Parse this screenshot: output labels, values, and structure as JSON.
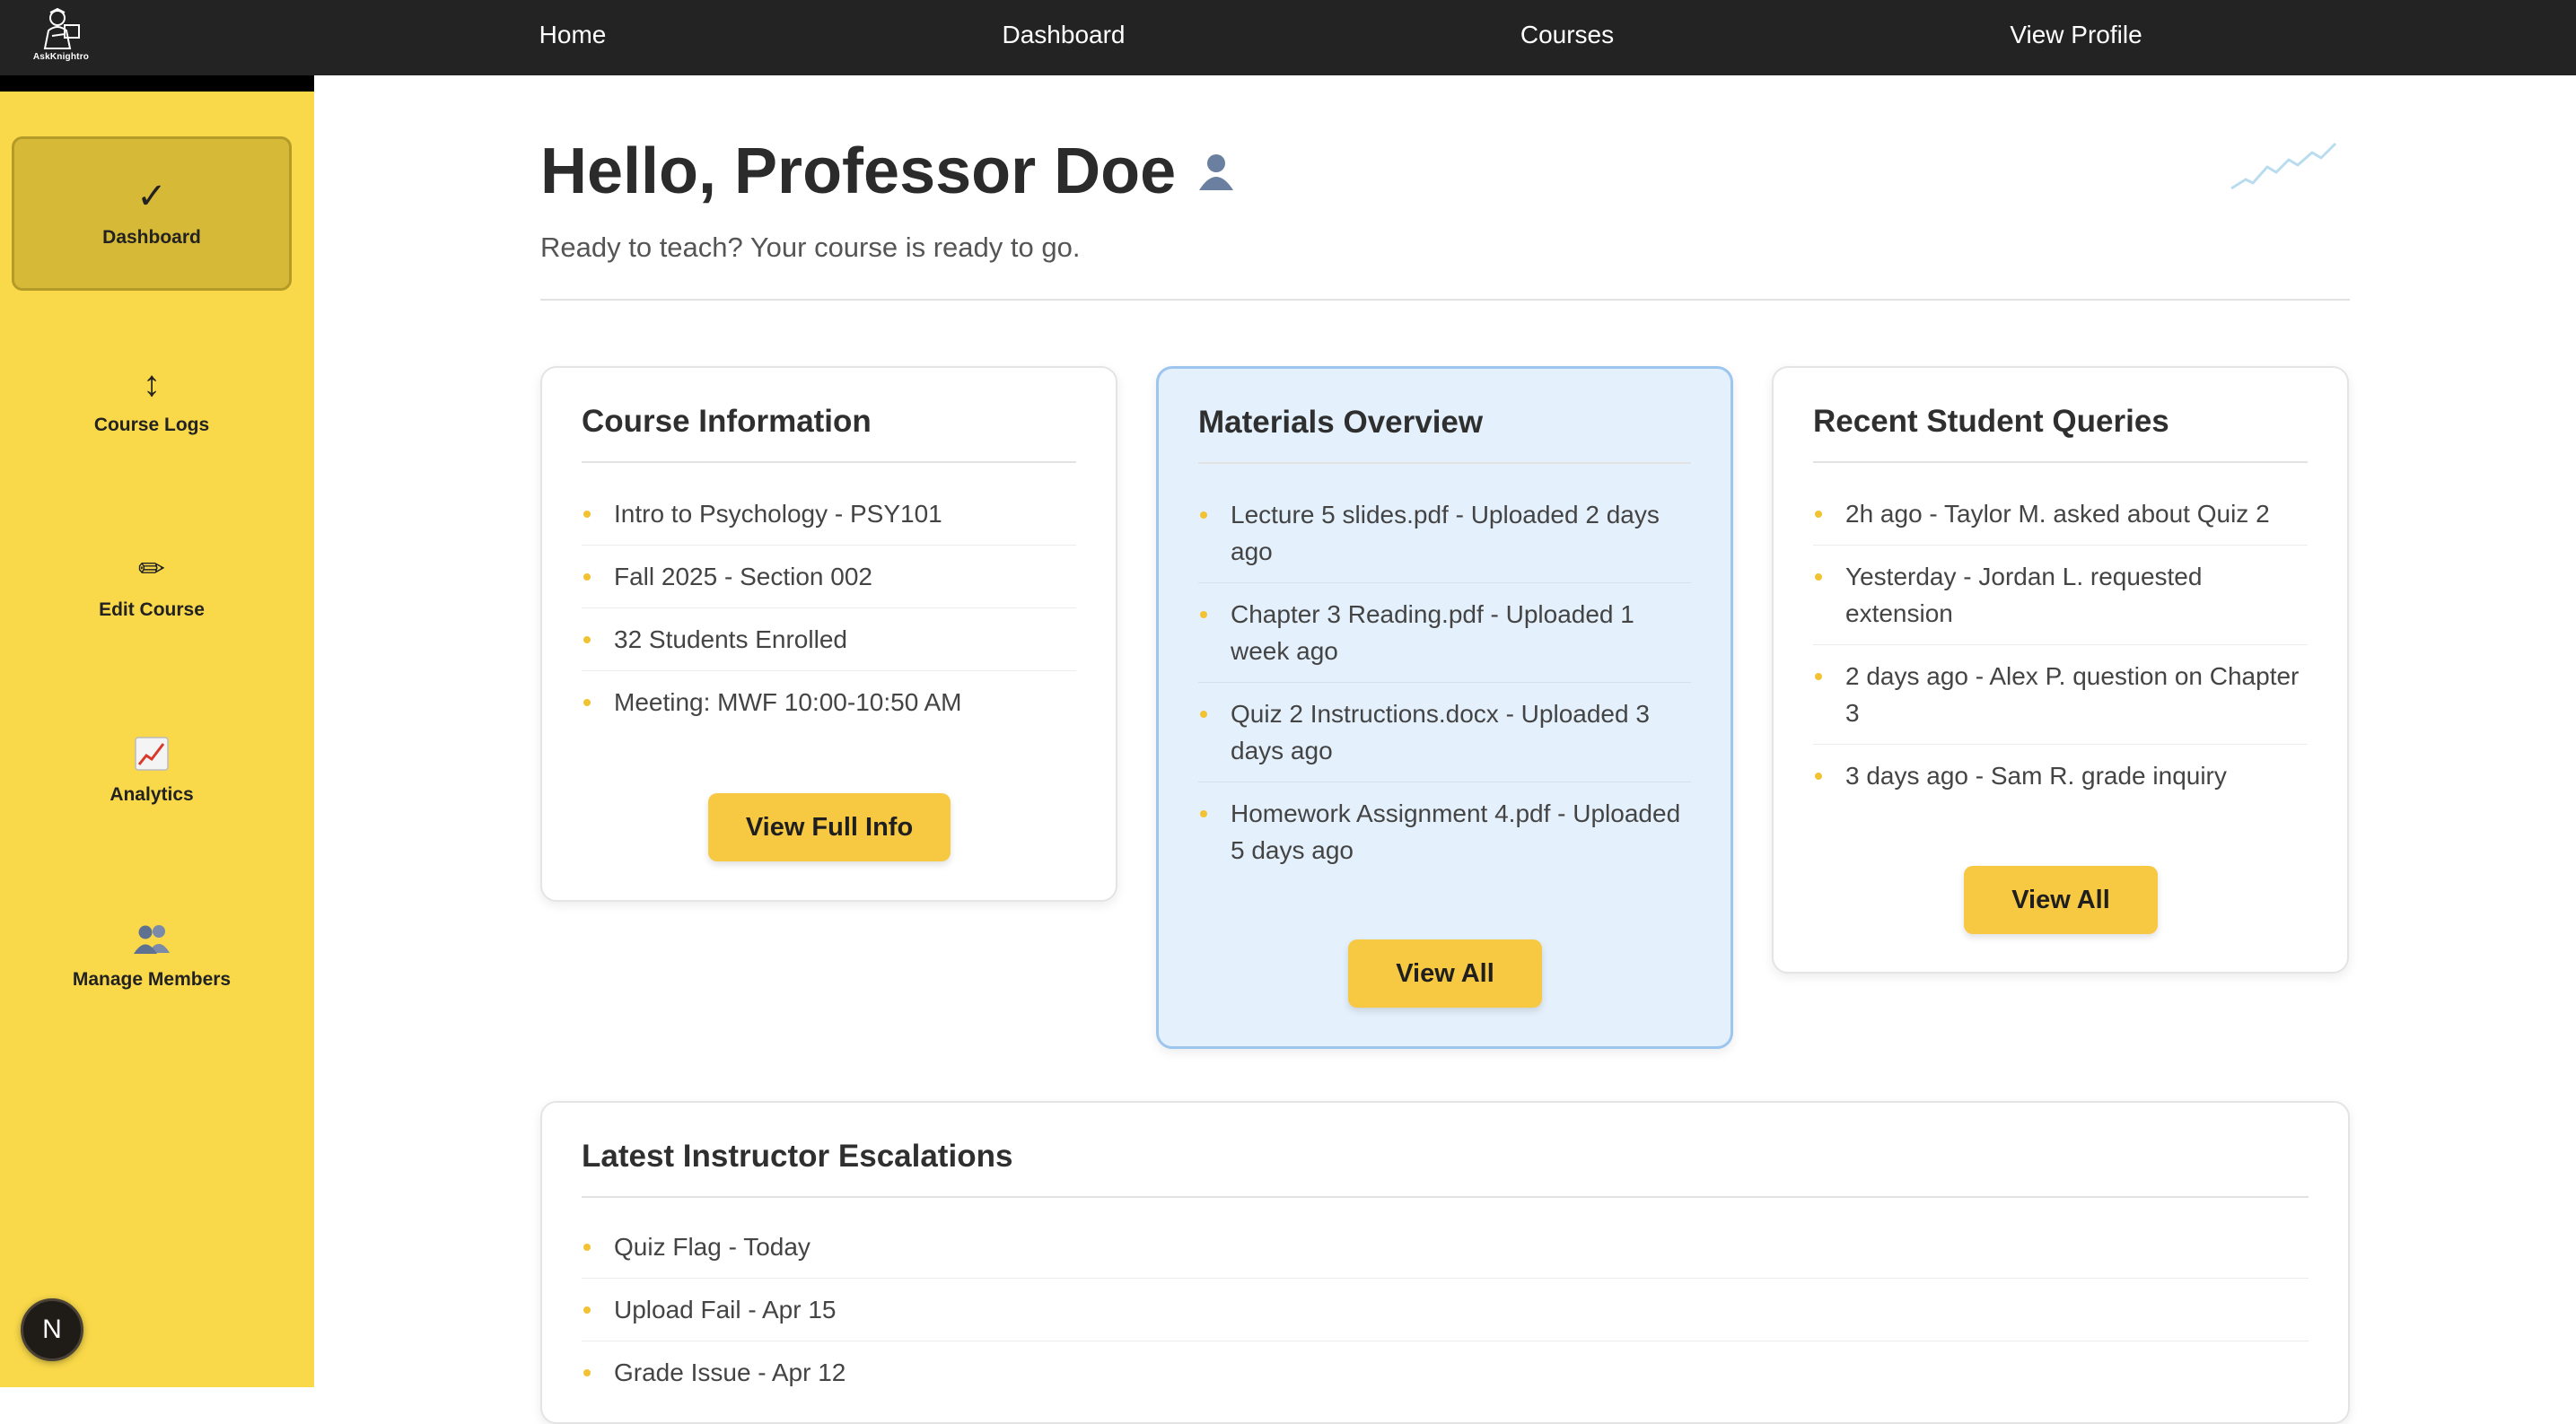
{
  "app": {
    "logo_text": "AskKnightro"
  },
  "nav": {
    "links": [
      "Home",
      "Dashboard",
      "Courses",
      "View Profile"
    ]
  },
  "sidebar": {
    "items": [
      {
        "label": "Dashboard",
        "icon": "checkmark-icon",
        "glyph": "✓",
        "active": true
      },
      {
        "label": "Course Logs",
        "icon": "up-down-arrow-icon",
        "glyph": "↕",
        "active": false
      },
      {
        "label": "Edit Course",
        "icon": "pencil-icon",
        "glyph": "✏",
        "active": false
      },
      {
        "label": "Analytics",
        "icon": "chart-increasing-icon",
        "glyph": "",
        "active": false
      },
      {
        "label": "Manage Members",
        "icon": "people-icon",
        "glyph": "",
        "active": false
      }
    ],
    "badge": "N"
  },
  "header": {
    "greeting": "Hello, Professor Doe",
    "subtitle": "Ready to teach? Your course is ready to go."
  },
  "cards": {
    "course_info": {
      "title": "Course Information",
      "items": [
        "Intro to Psychology - PSY101",
        "Fall 2025 - Section 002",
        "32 Students Enrolled",
        "Meeting: MWF 10:00-10:50 AM"
      ],
      "button": "View Full Info"
    },
    "materials": {
      "title": "Materials Overview",
      "items": [
        "Lecture 5 slides.pdf - Uploaded 2 days ago",
        "Chapter 3 Reading.pdf - Uploaded 1 week ago",
        "Quiz 2 Instructions.docx - Uploaded 3 days ago",
        "Homework Assignment 4.pdf - Uploaded 5 days ago"
      ],
      "button": "View All"
    },
    "queries": {
      "title": "Recent Student Queries",
      "items": [
        "2h ago - Taylor M. asked about Quiz 2",
        "Yesterday - Jordan L. requested extension",
        "2 days ago - Alex P. question on Chapter 3",
        "3 days ago - Sam R. grade inquiry"
      ],
      "button": "View All"
    },
    "escalations": {
      "title": "Latest Instructor Escalations",
      "items": [
        "Quiz Flag - Today",
        "Upload Fail - Apr 15",
        "Grade Issue - Apr 12"
      ]
    }
  },
  "colors": {
    "sidebar": "#f9d949",
    "topbar": "#232323",
    "accent_button": "#f7c842",
    "highlight_card": "#e4f0fb"
  }
}
